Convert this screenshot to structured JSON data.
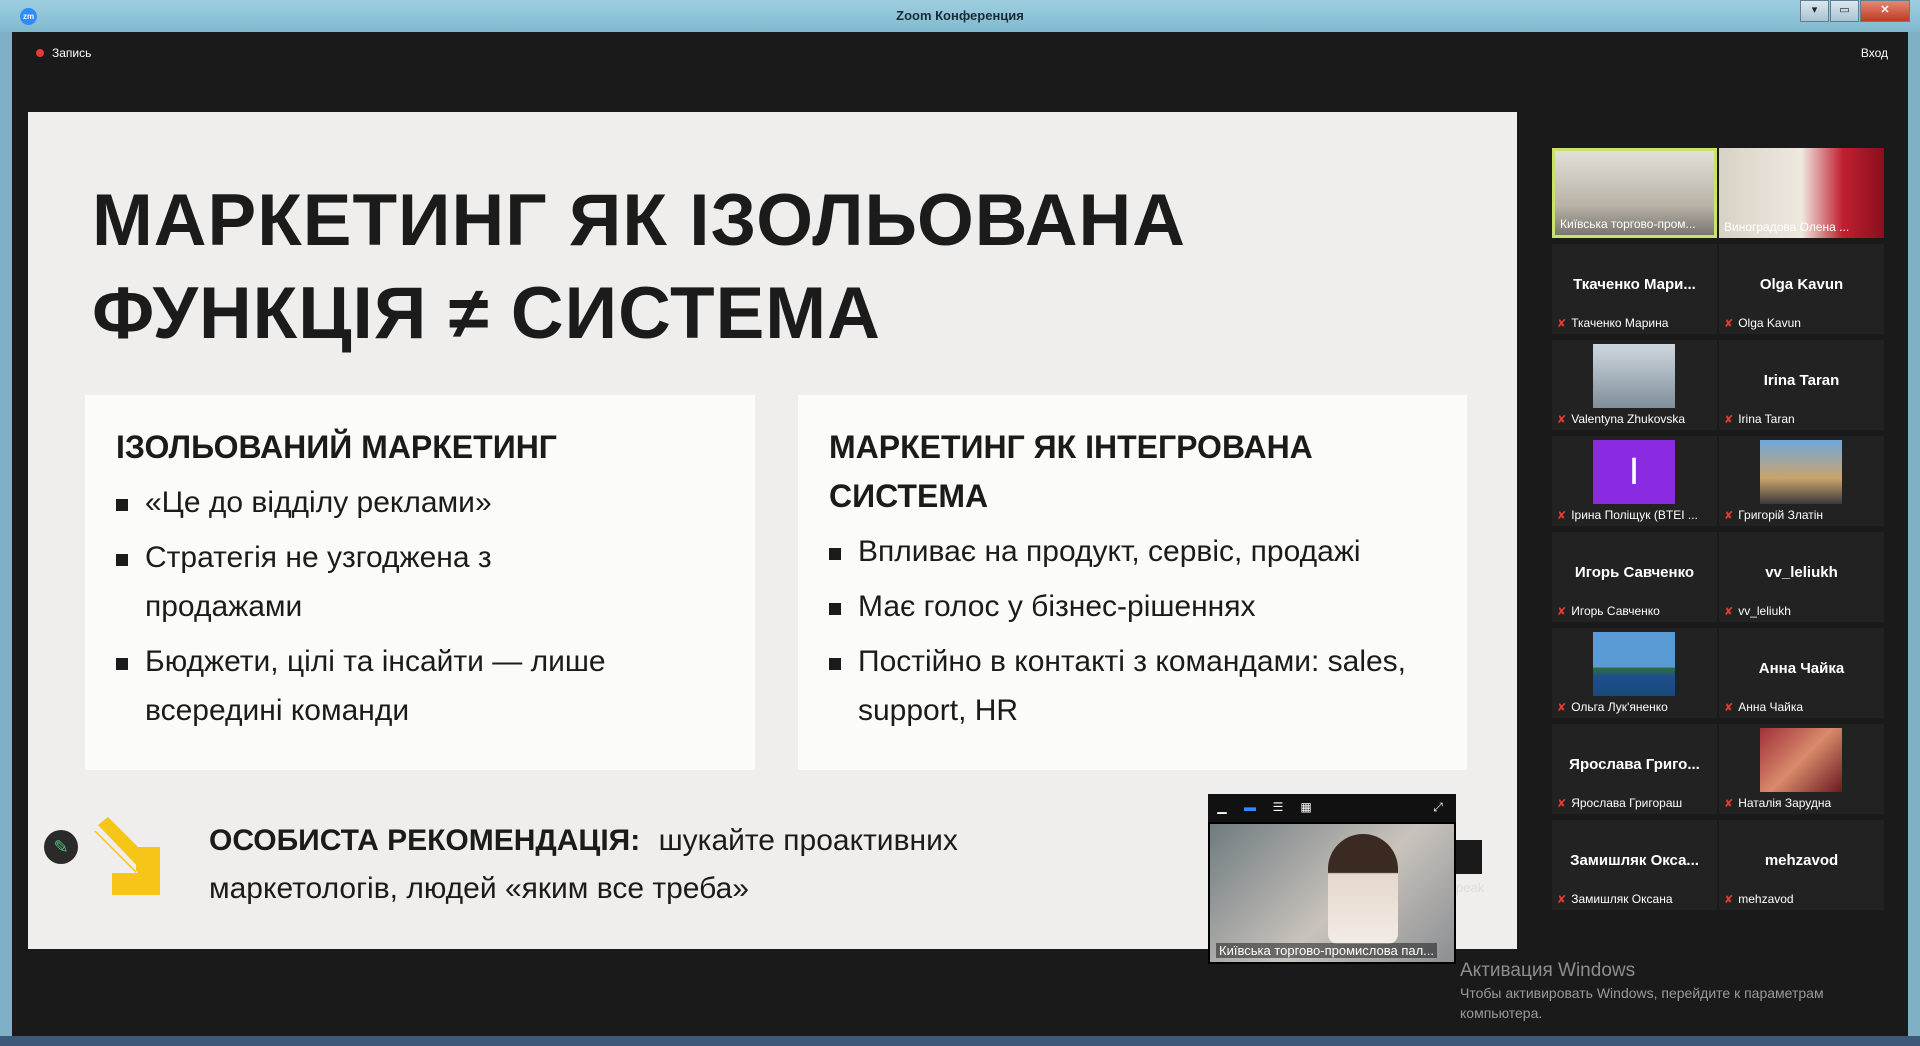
{
  "window": {
    "title": "Zoom Конференция",
    "logo": "zm",
    "controls": {
      "minimize": "▾",
      "restore": "▭",
      "close": "✕"
    }
  },
  "topbar": {
    "recording_label": "Запись",
    "login_label": "Вход"
  },
  "slide": {
    "title_line1": "МАРКЕТИНГ ЯК ІЗОЛЬОВАНА",
    "title_line2": "ФУНКЦІЯ ≠ СИСТЕМА",
    "left_card": {
      "title": "ІЗОЛЬОВАНИЙ МАРКЕТИНГ",
      "items": [
        "«Це до відділу реклами»",
        "Стратегія не узгоджена з продажами",
        "Бюджети, цілі та інсайти — лише всередині команди"
      ]
    },
    "right_card": {
      "title": "МАРКЕТИНГ ЯК ІНТЕГРОВАНА СИСТЕМА",
      "items": [
        "Впливає на продукт, сервіс, продажі",
        "Має голос у бізнес-рішеннях",
        "Постійно в контакті з командами: sales, support, HR"
      ]
    },
    "recommendation_label": "ОСОБИСТА РЕКОМЕНДАЦІЯ:",
    "recommendation_text": "шукайте проактивних маркетологів, людей «яким все треба»",
    "accent_color": "#f5c518"
  },
  "pip": {
    "speaker_name": "Київська торгово-промислова пал...",
    "speak_label": "peak"
  },
  "participants": [
    {
      "display": "",
      "label": "Київська торгово-пром...",
      "video": true,
      "active": true,
      "muted": false
    },
    {
      "display": "",
      "label": "Виноградова Олена ...",
      "video": true,
      "active": false,
      "muted": false
    },
    {
      "display": "Ткаченко  Мари...",
      "label": "Ткаченко Марина",
      "video": false,
      "muted": true
    },
    {
      "display": "Olga Kavun",
      "label": "Olga Kavun",
      "video": false,
      "muted": true
    },
    {
      "display": "",
      "label": "Valentyna Zhukovska",
      "video": true,
      "muted": true
    },
    {
      "display": "Irina Taran",
      "label": "Irina Taran",
      "video": false,
      "muted": true
    },
    {
      "display": "I",
      "label": "Ірина Поліщук (BTEI ...",
      "video": false,
      "avatar": true,
      "muted": true
    },
    {
      "display": "",
      "label": "Григорій Златін",
      "video": true,
      "muted": true
    },
    {
      "display": "Игорь Савченко",
      "label": "Игорь Савченко",
      "video": false,
      "muted": true
    },
    {
      "display": "vv_leliukh",
      "label": "vv_leliukh",
      "video": false,
      "muted": true
    },
    {
      "display": "",
      "label": "Ольга Лук'яненко",
      "video": true,
      "muted": true
    },
    {
      "display": "Анна Чайка",
      "label": "Анна Чайка",
      "video": false,
      "muted": true
    },
    {
      "display": "Ярослава  Григо...",
      "label": "Ярослава Григораш",
      "video": false,
      "muted": true
    },
    {
      "display": "",
      "label": "Наталія Зарудна",
      "video": true,
      "muted": true
    },
    {
      "display": "Замишляк  Окса...",
      "label": "Замишляк Оксана",
      "video": false,
      "muted": true
    },
    {
      "display": "mehzavod",
      "label": "mehzavod",
      "video": false,
      "muted": true
    }
  ],
  "watermark": {
    "title": "Активация Windows",
    "subtitle": "Чтобы активировать Windows, перейдите к параметрам компьютера."
  },
  "colors": {
    "frame": "#7fb0c6",
    "stage": "#1a1a1a",
    "slide_bg": "#efeeec",
    "active_border": "#c8e26b",
    "muted": "#e53935"
  }
}
